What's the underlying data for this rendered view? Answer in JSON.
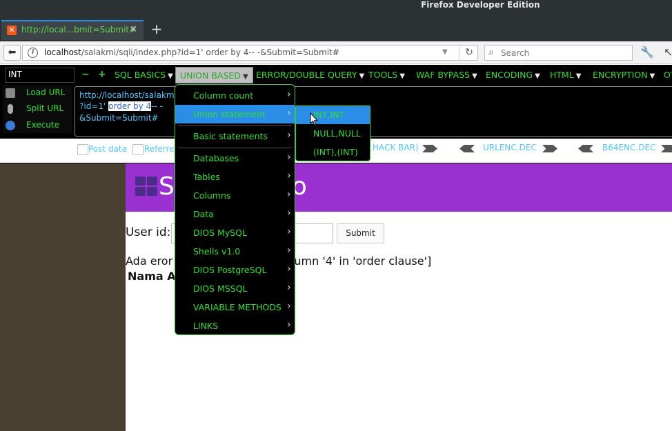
{
  "window": {
    "title": "Firefox Developer Edition"
  },
  "tab": {
    "title": "http://local...bmit=Submit#",
    "close": "×"
  },
  "newtab": "+",
  "nav": {
    "url_host": "localhost",
    "url_rest": "/salakmi/sqli/index.php?id=1' order by 4-- -&Submit=Submit#",
    "search_placeholder": "Search"
  },
  "hackbar": {
    "int_value": "INT",
    "menus": [
      "SQL BASICS",
      "UNION BASED",
      "ERROR/DOUBLE QUERY",
      "TOOLS",
      "WAF BYPASS",
      "ENCODING",
      "HTML",
      "ENCRYPTION",
      "OT"
    ],
    "left_actions": [
      "Load URL",
      "Split URL",
      "Execute"
    ],
    "url_lines": {
      "l1": "http://localhost/salakmi/s",
      "l2_pre": "?id=1'",
      "l2_sel": "order by 4",
      "l2_post": "-- -",
      "l3": "&Submit=Submit#"
    },
    "post_data": "Post data",
    "referrer": "Referrer",
    "hack_bar": "HACK BAR)",
    "urlenc": "URLENC.DEC",
    "b64enc": "B64ENC.DEC"
  },
  "dropdown": {
    "items": [
      "Column count",
      "Union statement",
      "Basic statements",
      "Databases",
      "Tables",
      "Columns",
      "Data",
      "DIOS MySQL",
      "Shells v1.0",
      "DIOS PostgreSQL",
      "DIOS MSSQL",
      "VARIABLE METHODS",
      "LINKS"
    ],
    "submenu": [
      "INT,INT",
      "NULL,NULL",
      "(INT),(INT)"
    ]
  },
  "page": {
    "header_left": "S",
    "header_right": "o",
    "user_label": "User id:",
    "submit": "Submit",
    "error_left": "Ada eror",
    "error_right": "olumn '4' in 'order clause']",
    "nama": "Nama A"
  },
  "colors": {
    "accent_green": "#2fe02f",
    "highlight_blue": "#2b8ee6",
    "header_purple": "#9b30d0"
  }
}
